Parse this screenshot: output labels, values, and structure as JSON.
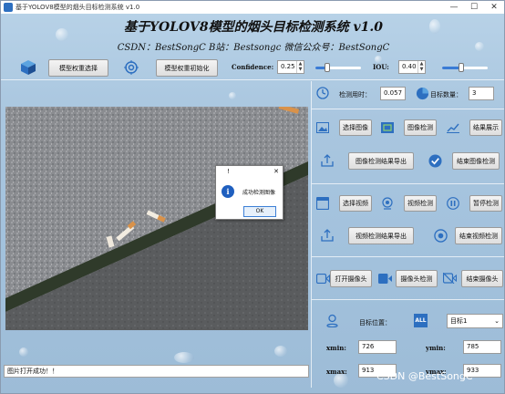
{
  "window": {
    "title": "基于YOLOV8模型的烟头目标检测系统 v1.0",
    "minimize": "—",
    "maximize": "☐",
    "close": "✕"
  },
  "header": {
    "title": "基于YOLOV8模型的烟头目标检测系统 v1.0",
    "subtitle": "CSDN：BestSongC   B站：Bestsongc   微信公众号：BestSongC"
  },
  "toolbar": {
    "select_weights": "模型权重选择",
    "init_weights": "模型权重初始化",
    "confidence_label": "Confidence:",
    "confidence_value": "0.25",
    "confidence_level": 0.25,
    "iou_label": "IOU:",
    "iou_value": "0.40",
    "iou_level": 0.4
  },
  "stats": {
    "time_label": "检测用时：",
    "time_value": "0.057",
    "count_label": "目标数量：",
    "count_value": "3"
  },
  "image_section": {
    "select_image": "选择图像",
    "detect_image": "图像检测",
    "show_result": "结果展示",
    "export_image": "图像检测结果导出",
    "finish_image": "结束图像检测"
  },
  "video_section": {
    "select_video": "选择视频",
    "detect_video": "视频检测",
    "pause_detect": "暂停检测",
    "export_video": "视频检测结果导出",
    "finish_video": "结束视频检测"
  },
  "camera_section": {
    "open_camera": "打开摄像头",
    "detect_camera": "摄像头检测",
    "close_camera": "结束摄像头"
  },
  "target": {
    "position_label": "目标位置：",
    "all_icon": "ALL",
    "select_value": "目标1",
    "xmin_label": "xmin:",
    "xmin": "726",
    "ymin_label": "ymin:",
    "ymin": "785",
    "xmax_label": "xmax:",
    "xmax": "913",
    "ymax_label": "ymax:",
    "ymax": "933"
  },
  "dialog": {
    "title": "!",
    "message": "成功检测图像",
    "ok": "OK",
    "close": "✕",
    "info_icon": "i"
  },
  "status": {
    "text": "图片打开成功！！"
  },
  "watermark": {
    "text": "CSDN @BestSongC"
  },
  "colors": {
    "accent": "#3a7bd5",
    "icon_blue": "#2d6fc0"
  }
}
